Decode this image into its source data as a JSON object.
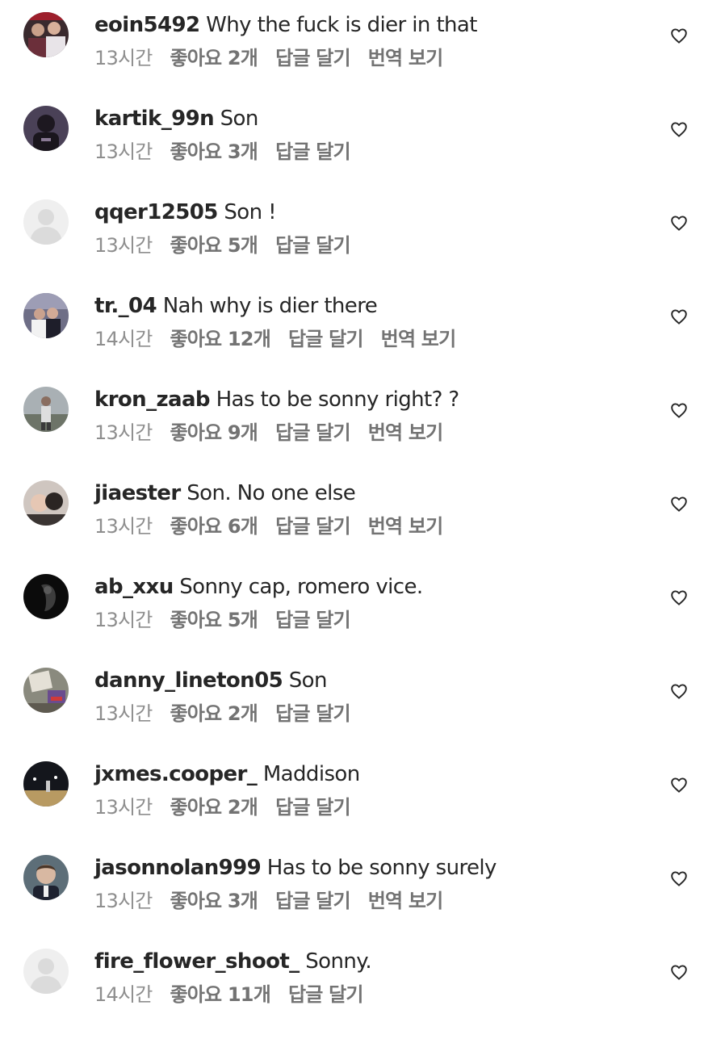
{
  "labels": {
    "reply": "답글 달기",
    "translate": "번역 보기"
  },
  "icons": {
    "like": "heart-outline-icon"
  },
  "comments": [
    {
      "username": "eoin5492",
      "text": "Why the fuck is dier in that",
      "time": "13시간",
      "likes": "좋아요 2개",
      "translate": true
    },
    {
      "username": "kartik_99n",
      "text": "Son",
      "time": "13시간",
      "likes": "좋아요 3개",
      "translate": false
    },
    {
      "username": "qqer12505",
      "text": "Son !",
      "time": "13시간",
      "likes": "좋아요 5개",
      "translate": false
    },
    {
      "username": "tr._04",
      "text": "Nah why is dier there",
      "time": "14시간",
      "likes": "좋아요 12개",
      "translate": true
    },
    {
      "username": "kron_zaab",
      "text": "Has to be sonny right? ?",
      "time": "13시간",
      "likes": "좋아요 9개",
      "translate": true
    },
    {
      "username": "jiaester",
      "text": "Son. No one else",
      "time": "13시간",
      "likes": "좋아요 6개",
      "translate": true
    },
    {
      "username": "ab_xxu",
      "text": "Sonny cap, romero vice.",
      "time": "13시간",
      "likes": "좋아요 5개",
      "translate": false
    },
    {
      "username": "danny_lineton05",
      "text": "Son",
      "time": "13시간",
      "likes": "좋아요 2개",
      "translate": false
    },
    {
      "username": "jxmes.cooper_",
      "text": "Maddison",
      "time": "13시간",
      "likes": "좋아요 2개",
      "translate": false
    },
    {
      "username": "jasonnolan999",
      "text": "Has to be sonny surely",
      "time": "13시간",
      "likes": "좋아요 3개",
      "translate": true
    },
    {
      "username": "fire_flower_shoot_",
      "text": "Sonny.",
      "time": "14시간",
      "likes": "좋아요 11개",
      "translate": false
    }
  ]
}
